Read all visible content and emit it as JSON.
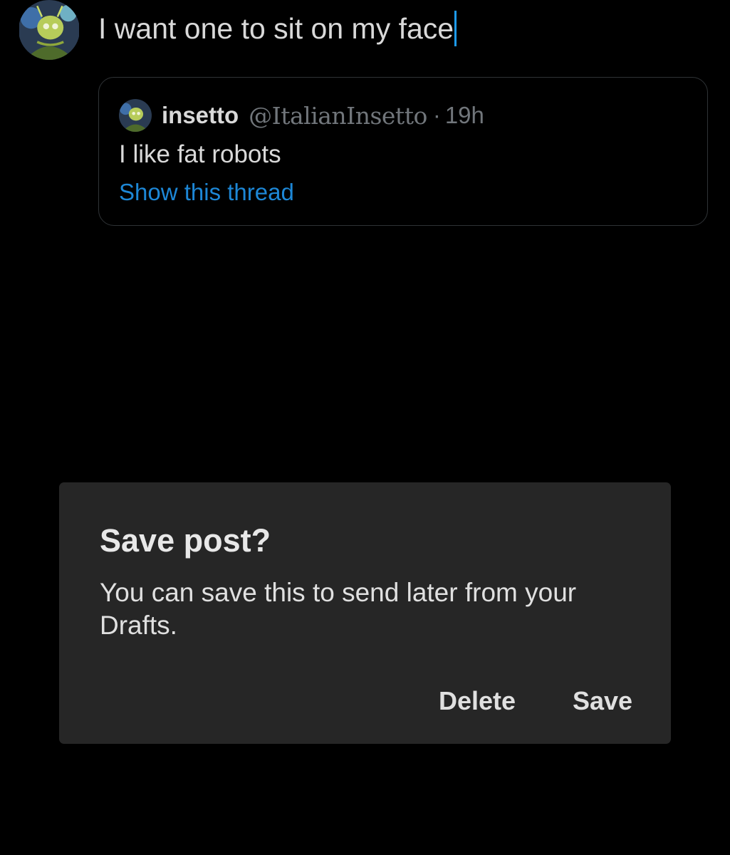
{
  "composer": {
    "text": "I want one to sit on my face",
    "avatar_icon": "user-avatar-icon"
  },
  "quoted_post": {
    "author_name": "insetto",
    "author_handle": "@ItalianInsetto",
    "separator": "·",
    "time": "19h",
    "body": "I like fat robots",
    "thread_link": "Show this thread",
    "avatar_icon": "user-avatar-icon"
  },
  "dialog": {
    "title": "Save post?",
    "message": "You can save this to send later from your Drafts.",
    "delete_label": "Delete",
    "save_label": "Save"
  },
  "colors": {
    "background": "#000000",
    "accent": "#1d9bf0",
    "link": "#1d87d6",
    "dialog_bg": "#262626",
    "muted_text": "#71767b"
  }
}
